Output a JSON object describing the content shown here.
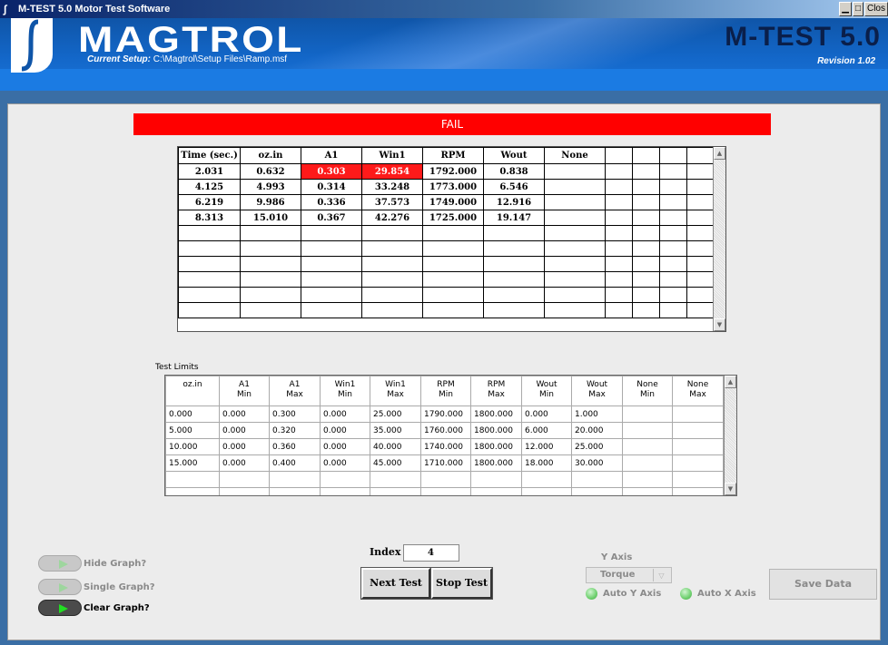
{
  "window": {
    "title": "M-TEST 5.0 Motor Test Software",
    "close_label": "Clos"
  },
  "header": {
    "brand": "MAGTROL",
    "setup_label": "Current Setup:",
    "setup_path": "C:\\Magtrol\\Setup Files\\Ramp.msf",
    "product": "M-TEST 5.0",
    "revision": "Revision 1.02"
  },
  "status": {
    "text": "FAIL",
    "color": "#ff0000"
  },
  "results": {
    "headers": [
      "Time (sec.)",
      "oz.in",
      "A1",
      "Win1",
      "RPM",
      "Wout",
      "None",
      "",
      "",
      "",
      ""
    ],
    "rows": [
      [
        "2.031",
        "0.632",
        "0.303",
        "29.854",
        "1792.000",
        "0.838",
        "",
        "",
        "",
        "",
        ""
      ],
      [
        "4.125",
        "4.993",
        "0.314",
        "33.248",
        "1773.000",
        "6.546",
        "",
        "",
        "",
        "",
        ""
      ],
      [
        "6.219",
        "9.986",
        "0.336",
        "37.573",
        "1749.000",
        "12.916",
        "",
        "",
        "",
        "",
        ""
      ],
      [
        "8.313",
        "15.010",
        "0.367",
        "42.276",
        "1725.000",
        "19.147",
        "",
        "",
        "",
        "",
        ""
      ],
      [
        "",
        "",
        "",
        "",
        "",
        "",
        "",
        "",
        "",
        "",
        ""
      ],
      [
        "",
        "",
        "",
        "",
        "",
        "",
        "",
        "",
        "",
        "",
        ""
      ],
      [
        "",
        "",
        "",
        "",
        "",
        "",
        "",
        "",
        "",
        "",
        ""
      ],
      [
        "",
        "",
        "",
        "",
        "",
        "",
        "",
        "",
        "",
        "",
        ""
      ],
      [
        "",
        "",
        "",
        "",
        "",
        "",
        "",
        "",
        "",
        "",
        ""
      ],
      [
        "",
        "",
        "",
        "",
        "",
        "",
        "",
        "",
        "",
        "",
        ""
      ]
    ],
    "failed_cells": [
      [
        0,
        2
      ],
      [
        0,
        3
      ]
    ]
  },
  "limits": {
    "label": "Test Limits",
    "headers": [
      [
        "oz.in",
        ""
      ],
      [
        "A1",
        "Min"
      ],
      [
        "A1",
        "Max"
      ],
      [
        "Win1",
        "Min"
      ],
      [
        "Win1",
        "Max"
      ],
      [
        "RPM",
        "Min"
      ],
      [
        "RPM",
        "Max"
      ],
      [
        "Wout",
        "Min"
      ],
      [
        "Wout",
        "Max"
      ],
      [
        "None",
        "Min"
      ],
      [
        "None",
        "Max"
      ]
    ],
    "rows": [
      [
        "0.000",
        "0.000",
        "0.300",
        "0.000",
        "25.000",
        "1790.000",
        "1800.000",
        "0.000",
        "1.000",
        "",
        ""
      ],
      [
        "5.000",
        "0.000",
        "0.320",
        "0.000",
        "35.000",
        "1760.000",
        "1800.000",
        "6.000",
        "20.000",
        "",
        ""
      ],
      [
        "10.000",
        "0.000",
        "0.360",
        "0.000",
        "40.000",
        "1740.000",
        "1800.000",
        "12.000",
        "25.000",
        "",
        ""
      ],
      [
        "15.000",
        "0.000",
        "0.400",
        "0.000",
        "45.000",
        "1710.000",
        "1800.000",
        "18.000",
        "30.000",
        "",
        ""
      ],
      [
        "",
        "",
        "",
        "",
        "",
        "",
        "",
        "",
        "",
        "",
        ""
      ],
      [
        "",
        "",
        "",
        "",
        "",
        "",
        "",
        "",
        "",
        "",
        ""
      ]
    ]
  },
  "toggles": {
    "hide_graph": {
      "label": "Hide Graph?",
      "on": false
    },
    "single_graph": {
      "label": "Single Graph?",
      "on": false
    },
    "clear_graph": {
      "label": "Clear Graph?",
      "on": true
    }
  },
  "index": {
    "label": "Index",
    "value": "4"
  },
  "buttons": {
    "next_test": "Next Test",
    "stop_test": "Stop Test",
    "save_data": "Save Data"
  },
  "y_axis": {
    "title": "Y Axis",
    "selected": "Torque",
    "auto_y_label": "Auto Y Axis",
    "auto_x_label": "Auto X Axis"
  }
}
